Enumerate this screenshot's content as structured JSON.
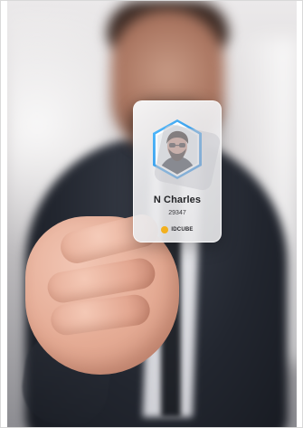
{
  "card": {
    "name": "N Charles",
    "id_number": "29347",
    "brand": "IDCUBE"
  },
  "colors": {
    "accent_blue": "#2ea0ea",
    "brand_yellow": "#f2b01e"
  }
}
